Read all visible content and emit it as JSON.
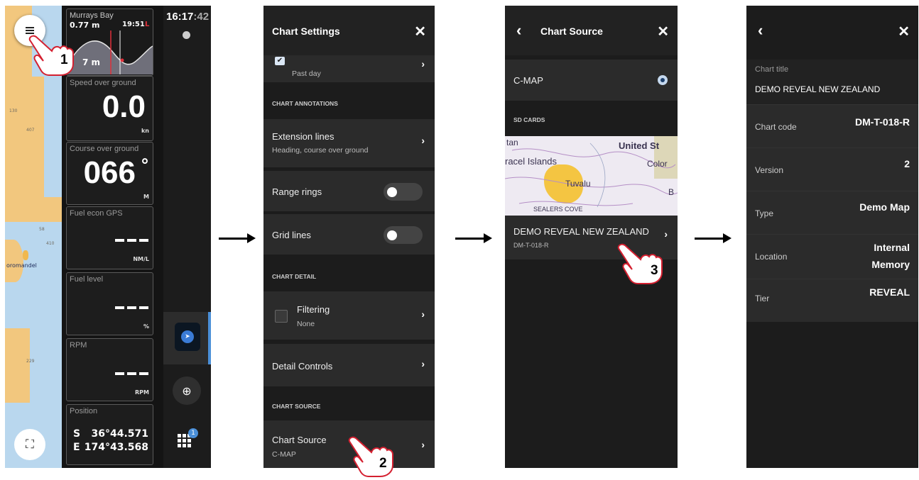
{
  "panel1": {
    "tide": {
      "location": "Murrays Bay",
      "height": "0.77 m",
      "time": "19:51",
      "tide_mark": "L",
      "overlay": "7 m"
    },
    "time": {
      "hhmm": "16:17",
      "ss": ":42"
    },
    "speed": {
      "label": "Speed over ground",
      "value": "0.0",
      "unit": "kn"
    },
    "course": {
      "label": "Course over ground",
      "value": "066",
      "deg": "°",
      "unit": "M"
    },
    "fuel_econ": {
      "label": "Fuel econ GPS",
      "unit": "NM/L"
    },
    "fuel_level": {
      "label": "Fuel level",
      "unit": "%"
    },
    "rpm": {
      "label": "RPM",
      "unit": "RPM"
    },
    "position": {
      "label": "Position",
      "lat_hem": "S",
      "lat": "36°44.571",
      "lon_hem": "E",
      "lon": "174°43.568"
    },
    "map_labels": {
      "place": "oromandel",
      "d1": "130",
      "d2": "407",
      "d3": "410",
      "d4": "229",
      "d5": "58"
    },
    "apps_badge": "1",
    "step": "1"
  },
  "panel2": {
    "title": "Chart Settings",
    "past_day": "Past day",
    "section_annotations": "CHART ANNOTATIONS",
    "extension_lines": "Extension lines",
    "extension_sub": "Heading, course over ground",
    "range_rings": "Range rings",
    "grid_lines": "Grid lines",
    "section_detail": "CHART DETAIL",
    "filtering": "Filtering",
    "filtering_sub": "None",
    "detail_controls": "Detail Controls",
    "section_source": "CHART SOURCE",
    "chart_source": "Chart Source",
    "chart_source_sub": "C-MAP",
    "step": "2"
  },
  "panel3": {
    "title": "Chart Source",
    "cmap": "C-MAP",
    "section_sd": "SD CARDS",
    "map_text": {
      "a": "United St",
      "b": "racel Islands",
      "c": "Tuvalu",
      "d": "Color",
      "e": "SEALERS COVE",
      "f": "B",
      "g": "tan"
    },
    "item_title": "DEMO REVEAL NEW ZEALAND",
    "item_code": "DM-T-018-R",
    "step": "3"
  },
  "panel4": {
    "chart_title_label": "Chart title",
    "chart_title_value": "DEMO REVEAL NEW ZEALAND",
    "rows": [
      {
        "key": "Chart code",
        "value": "DM-T-018-R"
      },
      {
        "key": "Version",
        "value": "2"
      },
      {
        "key": "Type",
        "value": "Demo Map"
      },
      {
        "key": "Location",
        "value": "Internal Memory"
      },
      {
        "key": "Tier",
        "value": "REVEAL"
      }
    ]
  },
  "colors": {
    "accent_blue": "#3a7bd5",
    "tide_low": "#e0303a",
    "rail_accent": "#4a8fd8"
  }
}
